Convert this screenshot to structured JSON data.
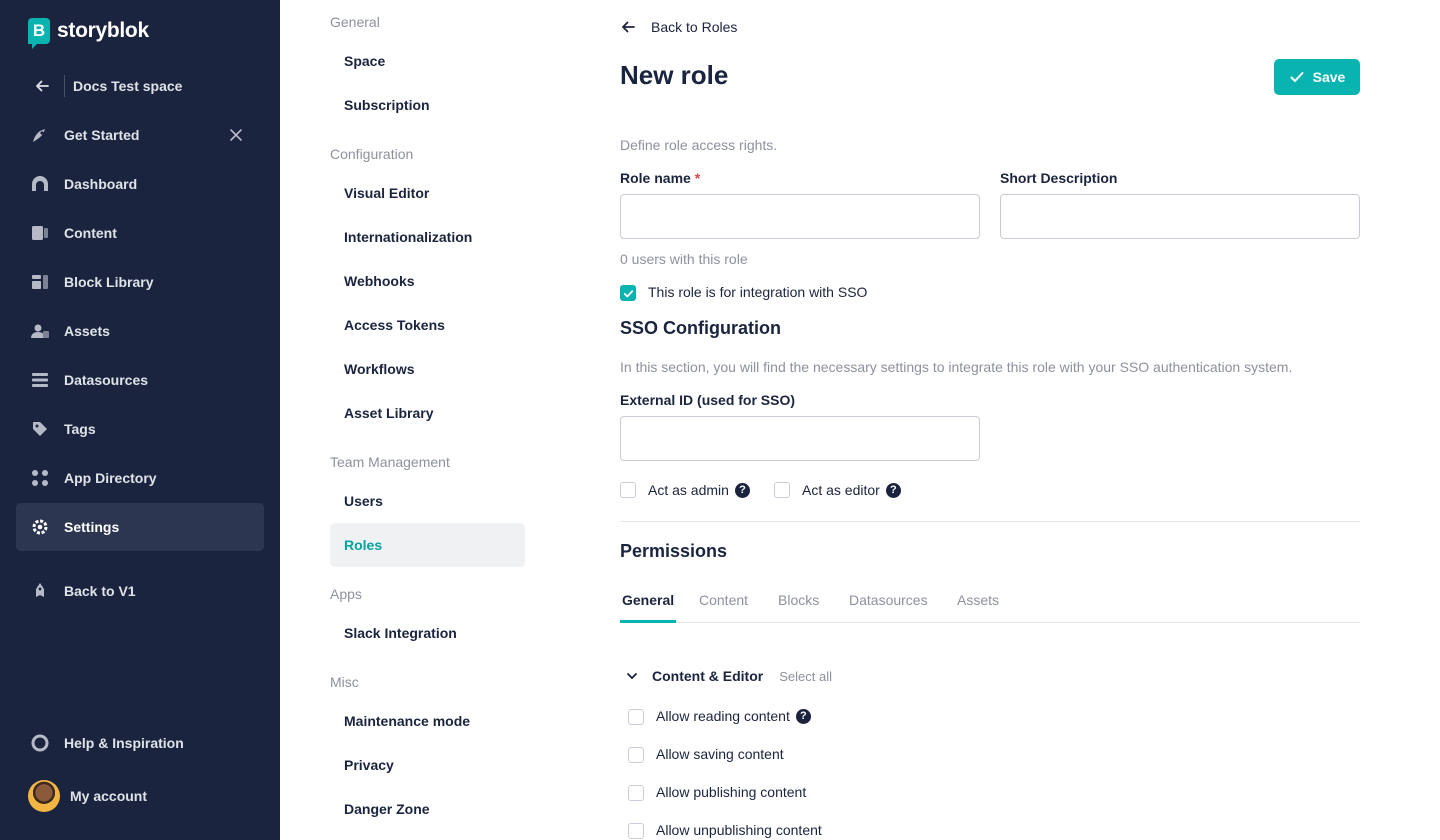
{
  "brand": {
    "name": "storyblok",
    "mark": "B",
    "accent": "#09b3af",
    "sidebar_bg": "#1b243f"
  },
  "space": {
    "name": "Docs Test space"
  },
  "sidebar": {
    "items": [
      {
        "label": "Get Started",
        "icon": "rocket-icon"
      },
      {
        "label": "Dashboard",
        "icon": "dashboard-icon"
      },
      {
        "label": "Content",
        "icon": "content-icon"
      },
      {
        "label": "Block Library",
        "icon": "blocks-icon"
      },
      {
        "label": "Assets",
        "icon": "assets-icon"
      },
      {
        "label": "Datasources",
        "icon": "datasources-icon"
      },
      {
        "label": "Tags",
        "icon": "tag-icon"
      },
      {
        "label": "App Directory",
        "icon": "apps-icon"
      },
      {
        "label": "Settings",
        "icon": "gear-icon",
        "active": true
      },
      {
        "label": "Back to V1",
        "icon": "back-v1-icon"
      }
    ],
    "help": {
      "label": "Help & Inspiration"
    },
    "account": {
      "label": "My account"
    }
  },
  "settings_nav": {
    "sections": [
      {
        "title": "General",
        "items": [
          "Space",
          "Subscription"
        ]
      },
      {
        "title": "Configuration",
        "items": [
          "Visual Editor",
          "Internationalization",
          "Webhooks",
          "Access Tokens",
          "Workflows",
          "Asset Library"
        ]
      },
      {
        "title": "Team Management",
        "items": [
          "Users",
          "Roles"
        ]
      },
      {
        "title": "Apps",
        "items": [
          "Slack Integration"
        ]
      },
      {
        "title": "Misc",
        "items": [
          "Maintenance mode",
          "Privacy",
          "Danger Zone"
        ]
      }
    ],
    "active": "Roles"
  },
  "main": {
    "back_label": "Back to Roles",
    "title": "New role",
    "save_label": "Save",
    "intro": "Define role access rights.",
    "role_name_label": "Role name",
    "required_mark": "*",
    "role_name_value": "",
    "short_description_label": "Short Description",
    "short_description_value": "",
    "users_count_text": "0 users with this role",
    "sso_checkbox_label": "This role is for integration with SSO",
    "sso_checked": true,
    "sso_title": "SSO Configuration",
    "sso_description": "In this section, you will find the necessary settings to integrate this role with your SSO authentication system.",
    "external_id_label": "External ID (used for SSO)",
    "external_id_value": "",
    "act_as_admin_label": "Act as admin",
    "act_as_editor_label": "Act as editor",
    "help_glyph": "?",
    "permissions_title": "Permissions",
    "tabs": [
      "General",
      "Content",
      "Blocks",
      "Datasources",
      "Assets"
    ],
    "active_tab": "General",
    "group": {
      "title": "Content & Editor",
      "select_all": "Select all",
      "permissions": [
        {
          "label": "Allow reading content",
          "help": true,
          "checked": false
        },
        {
          "label": "Allow saving content",
          "help": false,
          "checked": false
        },
        {
          "label": "Allow publishing content",
          "help": false,
          "checked": false
        },
        {
          "label": "Allow unpublishing content",
          "help": false,
          "checked": false
        }
      ]
    }
  }
}
